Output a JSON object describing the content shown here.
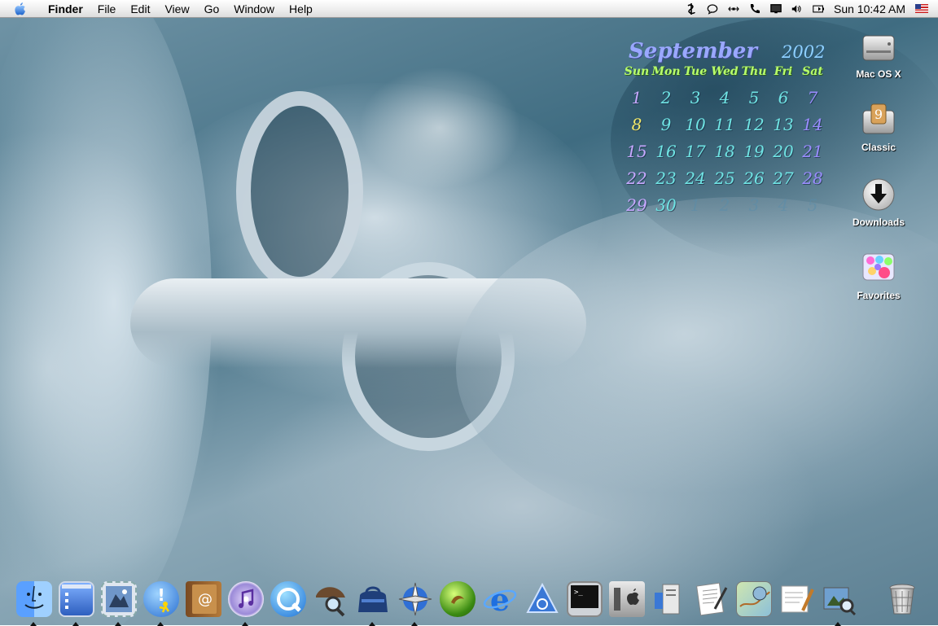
{
  "menubar": {
    "apple_icon": "apple-logo-icon",
    "app_name": "Finder",
    "menus": [
      "File",
      "Edit",
      "View",
      "Go",
      "Window",
      "Help"
    ],
    "status_icons": [
      "script-icon",
      "ichat-icon",
      "network-icon",
      "phone-icon",
      "display-icon",
      "volume-icon",
      "battery-icon"
    ],
    "clock": "Sun 10:42 AM",
    "input_flag": "us-flag-icon"
  },
  "calendar": {
    "month": "September",
    "year": "2002",
    "weekdays": [
      "Sun",
      "Mon",
      "Tue",
      "Wed",
      "Thu",
      "Fri",
      "Sat"
    ],
    "weeks": [
      [
        "1",
        "2",
        "3",
        "4",
        "5",
        "6",
        "7"
      ],
      [
        "8",
        "9",
        "10",
        "11",
        "12",
        "13",
        "14"
      ],
      [
        "15",
        "16",
        "17",
        "18",
        "19",
        "20",
        "21"
      ],
      [
        "22",
        "23",
        "24",
        "25",
        "26",
        "27",
        "28"
      ],
      [
        "29",
        "30",
        "1",
        "2",
        "3",
        "4",
        "5"
      ]
    ],
    "today": "8",
    "colors": {
      "month": "#9aa8ff",
      "weekday": "#b8ff6a",
      "today": "#f2e96a"
    }
  },
  "desktop_icons": [
    {
      "label": "Mac OS X",
      "icon": "hard-drive-icon"
    },
    {
      "label": "Classic",
      "icon": "classic-drive-icon"
    },
    {
      "label": "Downloads",
      "icon": "download-arrow-icon"
    },
    {
      "label": "Favorites",
      "icon": "favorites-icon"
    }
  ],
  "dock": [
    {
      "name": "finder",
      "icon": "finder-icon",
      "running": true
    },
    {
      "name": "desktop-manager",
      "icon": "desktop-window-icon",
      "running": true
    },
    {
      "name": "mail",
      "icon": "mail-stamp-icon",
      "running": true
    },
    {
      "name": "aim",
      "icon": "aim-runner-icon",
      "running": true
    },
    {
      "name": "address-book",
      "icon": "address-book-icon",
      "running": false
    },
    {
      "name": "itunes",
      "icon": "itunes-icon",
      "running": true
    },
    {
      "name": "quicktime",
      "icon": "quicktime-icon",
      "running": false
    },
    {
      "name": "sherlock",
      "icon": "sherlock-icon",
      "running": false
    },
    {
      "name": "idisk",
      "icon": "idisk-bag-icon",
      "running": true
    },
    {
      "name": "internet-connect",
      "icon": "globe-compass-icon",
      "running": true
    },
    {
      "name": "ftp-client",
      "icon": "green-ball-icon",
      "running": false
    },
    {
      "name": "internet-explorer",
      "icon": "internet-explorer-icon",
      "running": false
    },
    {
      "name": "aol",
      "icon": "triangle-app-icon",
      "running": false
    },
    {
      "name": "terminal",
      "icon": "terminal-icon",
      "running": false
    },
    {
      "name": "system-preferences",
      "icon": "system-preferences-icon",
      "running": false
    },
    {
      "name": "server",
      "icon": "server-tower-icon",
      "running": false
    },
    {
      "name": "text-editor",
      "icon": "text-document-icon",
      "running": false
    },
    {
      "name": "map-app",
      "icon": "map-icon",
      "running": false
    },
    {
      "name": "utility",
      "icon": "globe-stand-icon",
      "running": false
    },
    {
      "name": "script-editor",
      "icon": "script-editor-icon",
      "running": false
    },
    {
      "name": "preview",
      "icon": "preview-icon",
      "running": true
    },
    {
      "name": "trash",
      "icon": "trash-icon",
      "running": false
    }
  ]
}
